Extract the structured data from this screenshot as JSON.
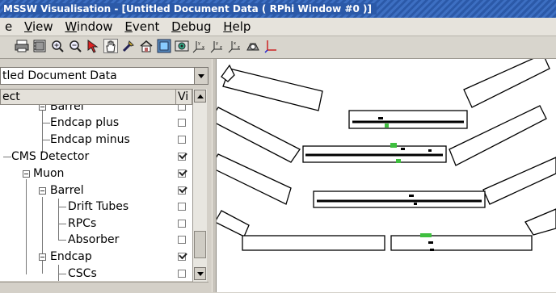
{
  "window": {
    "title": "MSSW Visualisation - [Untitled Document Data ( RPhi Window #0 )]"
  },
  "menubar": {
    "items": [
      {
        "pre": "",
        "u": "",
        "post": "e"
      },
      {
        "pre": "",
        "u": "V",
        "post": "iew"
      },
      {
        "pre": "",
        "u": "W",
        "post": "indow"
      },
      {
        "pre": "",
        "u": "E",
        "post": "vent"
      },
      {
        "pre": "",
        "u": "D",
        "post": "ebug"
      },
      {
        "pre": "",
        "u": "H",
        "post": "elp"
      }
    ]
  },
  "toolbar": {
    "icons": [
      "print-icon",
      "film-icon",
      "zoom-in-icon",
      "zoom-out-icon",
      "select-arrow-icon",
      "hand-pan-icon",
      "pick-icon",
      "home-icon",
      "view-3d-icon",
      "camera-view-icon",
      "axis-xy-icon",
      "axis-yz-icon",
      "axis-xz-icon",
      "snapshot-icon",
      "axes-icon"
    ],
    "accent": "#2b59a8"
  },
  "document_combo": {
    "value": "tled Document Data"
  },
  "tree": {
    "header_object": "ect",
    "header_visible": "Vi",
    "rows": [
      {
        "label": "Barrel",
        "checked": false
      },
      {
        "label": "Endcap plus",
        "checked": false
      },
      {
        "label": "Endcap minus",
        "checked": false
      },
      {
        "label": "CMS Detector",
        "checked": true
      },
      {
        "label": "Muon",
        "checked": true
      },
      {
        "label": "Barrel",
        "checked": true
      },
      {
        "label": "Drift Tubes",
        "checked": false
      },
      {
        "label": "RPCs",
        "checked": false
      },
      {
        "label": "Absorber",
        "checked": false
      },
      {
        "label": "Endcap",
        "checked": true
      },
      {
        "label": "CSCs",
        "checked": false
      }
    ]
  },
  "viewport": {
    "hit_color": "#3fbf3f"
  }
}
